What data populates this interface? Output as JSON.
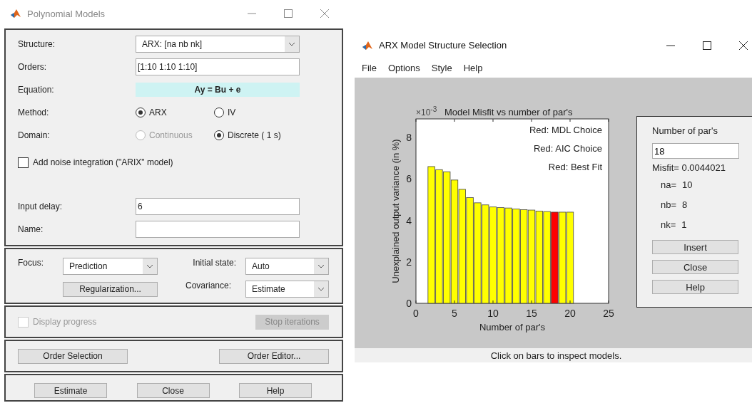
{
  "left_window": {
    "title": "Polynomial Models",
    "structure": {
      "label": "Structure:",
      "value": "ARX: [na nb nk]"
    },
    "orders": {
      "label": "Orders:",
      "value": "[1:10 1:10 1:10]"
    },
    "equation": {
      "label": "Equation:",
      "value": "Ay = Bu + e"
    },
    "method": {
      "label": "Method:",
      "options": [
        {
          "label": "ARX",
          "selected": true,
          "disabled": false
        },
        {
          "label": "IV",
          "selected": false,
          "disabled": false
        }
      ]
    },
    "domain": {
      "label": "Domain:",
      "options": [
        {
          "label": "Continuous",
          "selected": false,
          "disabled": true
        },
        {
          "label": "Discrete ( 1 s)",
          "selected": true,
          "disabled": false
        }
      ]
    },
    "noise_integration": {
      "label": "Add noise integration (\"ARIX\" model)",
      "checked": false
    },
    "input_delay": {
      "label": "Input delay:",
      "value": "6"
    },
    "name": {
      "label": "Name:"
    },
    "focus": {
      "label": "Focus:",
      "value": "Prediction"
    },
    "regularization_button": "Regularization...",
    "initial_state": {
      "label": "Initial state:",
      "value": "Auto"
    },
    "covariance": {
      "label": "Covariance:",
      "value": "Estimate"
    },
    "display_progress": {
      "label": "Display progress",
      "checked": false,
      "disabled": true
    },
    "stop_button": {
      "label": "Stop iterations",
      "disabled": true
    },
    "order_buttons": [
      "Order Selection",
      "Order Editor..."
    ],
    "action_buttons": [
      "Estimate",
      "Close",
      "Help"
    ]
  },
  "right_window": {
    "title": "ARX Model Structure Selection",
    "menu": [
      "File",
      "Options",
      "Style",
      "Help"
    ],
    "chart": {
      "axis_multiplier": "×10$^{-3}$",
      "chart_data": {
        "type": "bar",
        "title": "Model Misfit vs number of par's",
        "xlabel": "Number of par's",
        "ylabel": "Unexplained output variance (in %)",
        "x": [
          2,
          3,
          4,
          5,
          6,
          7,
          8,
          9,
          10,
          11,
          12,
          13,
          14,
          15,
          16,
          17,
          18,
          19,
          20
        ],
        "series": [
          {
            "color": "#ffff00",
            "values": [
              6.6,
              6.45,
              6.35,
              5.95,
              5.5,
              5.1,
              4.85,
              4.75,
              4.65,
              4.62,
              4.6,
              4.55,
              4.52,
              4.5,
              4.45,
              4.43,
              null,
              4.4,
              4.4
            ]
          },
          {
            "color": "#ff0000",
            "values": [
              null,
              null,
              null,
              null,
              null,
              null,
              null,
              null,
              null,
              null,
              null,
              null,
              null,
              null,
              null,
              null,
              4.4,
              null,
              null
            ]
          }
        ],
        "stacked": true,
        "xlim": [
          0,
          25
        ],
        "ylim": [
          0,
          8.9
        ],
        "xticks": [
          0,
          5,
          10,
          15,
          20,
          25
        ],
        "yticks": [
          0,
          2,
          4,
          6,
          8
        ],
        "annotations": [
          "Red: MDL Choice",
          "Red: AIC Choice",
          "Red: Best Fit"
        ]
      }
    },
    "side_panel": {
      "label": "Number of par's",
      "value": "18",
      "misfit": "Misfit= 0.0044021",
      "params": [
        {
          "label": "na=",
          "value": "10"
        },
        {
          "label": "nb=",
          "value": "8"
        },
        {
          "label": "nk=",
          "value": "1"
        }
      ],
      "buttons": [
        "Insert",
        "Close",
        "Help"
      ]
    },
    "status": "Click on bars to inspect models."
  }
}
